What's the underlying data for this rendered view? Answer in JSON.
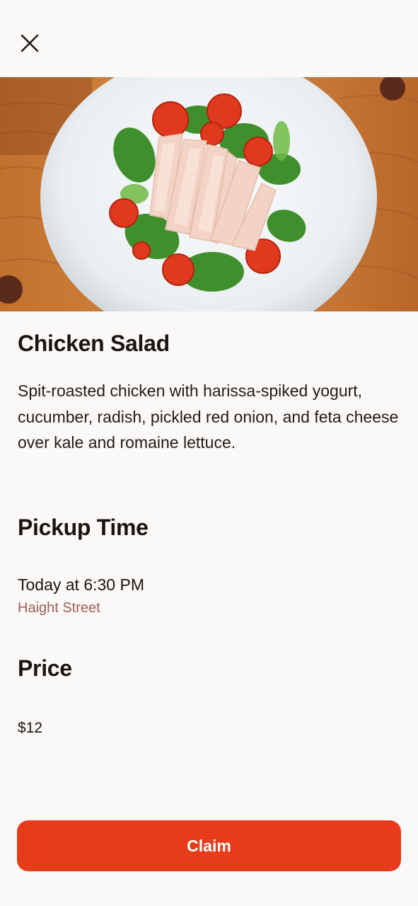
{
  "header": {
    "close_icon": "close-icon"
  },
  "item": {
    "image": "salad-photo",
    "title": "Chicken Salad",
    "description": "Spit-roasted chicken with harissa-spiked yogurt, cucumber, radish, pickled red onion, and feta cheese over kale and romaine lettuce."
  },
  "pickup": {
    "heading": "Pickup Time",
    "time": "Today at 6:30 PM",
    "location": "Haight Street"
  },
  "price": {
    "heading": "Price",
    "value": "$12"
  },
  "actions": {
    "claim_label": "Claim"
  },
  "colors": {
    "accent": "#e63c1c",
    "background": "#fbf9f7",
    "location_text": "#9a5f55"
  }
}
